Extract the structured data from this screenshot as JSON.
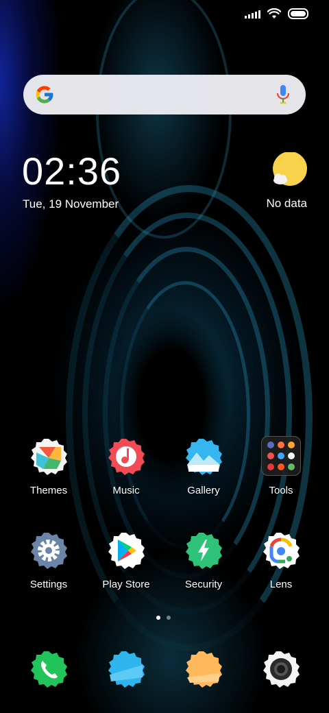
{
  "status_bar": {
    "signal_icon": "signal-icon",
    "wifi_icon": "wifi-icon",
    "battery_icon": "battery-icon",
    "battery_level": 1.0
  },
  "search_widget": {
    "logo_icon": "google-logo-icon",
    "mic_icon": "microphone-icon"
  },
  "clock_widget": {
    "time": "02:36",
    "date": "Tue, 19 November"
  },
  "weather_widget": {
    "icon": "sun-cloud-icon",
    "text": "No data"
  },
  "apps": [
    {
      "label": "Themes",
      "icon": "themes-icon",
      "color": "#f0653e"
    },
    {
      "label": "Music",
      "icon": "music-icon",
      "color": "#f24b55"
    },
    {
      "label": "Gallery",
      "icon": "gallery-icon",
      "color": "#35b6f0"
    },
    {
      "label": "Tools",
      "icon": "tools-folder-icon",
      "color": "#1f1f1f"
    },
    {
      "label": "Settings",
      "icon": "gear-icon",
      "color": "#6c84a8"
    },
    {
      "label": "Play Store",
      "icon": "play-store-icon",
      "color": "#ffffff"
    },
    {
      "label": "Security",
      "icon": "security-icon",
      "color": "#2fc37a"
    },
    {
      "label": "Lens",
      "icon": "lens-icon",
      "color": "#ffffff"
    }
  ],
  "page_indicator": {
    "pages": 2,
    "current": 1
  },
  "dock": [
    {
      "name": "phone",
      "icon": "phone-icon",
      "color": "#22c35a"
    },
    {
      "name": "messages",
      "icon": "message-icon",
      "color": "#2fb5ee"
    },
    {
      "name": "browser",
      "icon": "browser-icon",
      "color": "#ffb95c"
    },
    {
      "name": "camera",
      "icon": "camera-icon",
      "color": "#f4f4f4"
    }
  ]
}
